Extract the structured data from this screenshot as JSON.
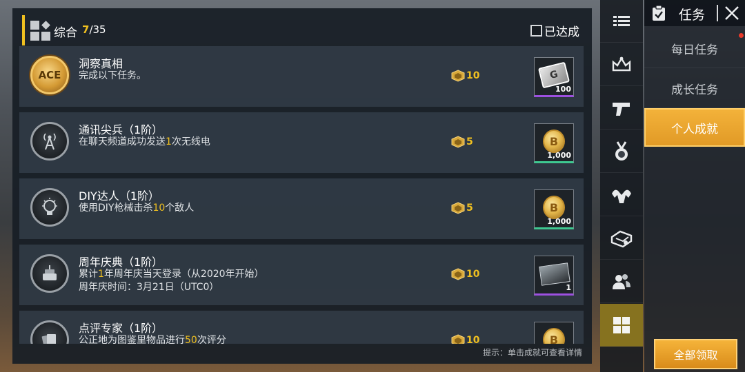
{
  "header": {
    "category": "综合",
    "progress_done": "7",
    "progress_total": "/35",
    "achieved_filter_label": "已达成"
  },
  "achievements": [
    {
      "title": "洞察真相",
      "desc_parts": [
        {
          "t": "完成以下任务。",
          "hl": false
        }
      ],
      "points": "10",
      "badge": "gold-ace-badge-icon",
      "reward_icon": "g-ticket-icon",
      "reward_count": "100",
      "reward_rarity": "purple"
    },
    {
      "title": "通讯尖兵（1阶）",
      "desc_parts": [
        {
          "t": "在聊天频道成功发送",
          "hl": false
        },
        {
          "t": "1",
          "hl": true
        },
        {
          "t": "次无线电",
          "hl": false
        }
      ],
      "points": "5",
      "badge": "radio-tower-badge-icon",
      "reward_icon": "bp-coin-icon",
      "reward_count": "1,000",
      "reward_rarity": "green"
    },
    {
      "title": "DIY达人（1阶）",
      "desc_parts": [
        {
          "t": "使用DIY枪械击杀",
          "hl": false
        },
        {
          "t": "10",
          "hl": true
        },
        {
          "t": "个敌人",
          "hl": false
        }
      ],
      "points": "5",
      "badge": "diy-bulb-badge-icon",
      "reward_icon": "bp-coin-icon",
      "reward_count": "1,000",
      "reward_rarity": "green"
    },
    {
      "title": "周年庆典（1阶）",
      "desc_parts": [
        {
          "t": "累计",
          "hl": false
        },
        {
          "t": "1",
          "hl": true
        },
        {
          "t": "年周年庆当天登录（从2020年开始）",
          "hl": false
        }
      ],
      "desc2": "周年庆时间：3月21日（UTC0）",
      "points": "10",
      "badge": "anniversary-cake-badge-icon",
      "reward_icon": "supply-crate-icon",
      "reward_count": "1",
      "reward_rarity": "purple"
    },
    {
      "title": "点评专家（1阶）",
      "desc_parts": [
        {
          "t": "公正地为图鉴里物品进行",
          "hl": false
        },
        {
          "t": "50",
          "hl": true
        },
        {
          "t": "次评分",
          "hl": false
        }
      ],
      "points": "10",
      "badge": "review-cards-badge-icon",
      "reward_icon": "bp-coin-icon",
      "reward_count": "",
      "reward_rarity": "green"
    }
  ],
  "footer_hint": "提示：单击成就可查看详情",
  "side_icons": [
    {
      "name": "menu-list-icon",
      "active": false
    },
    {
      "name": "crown-icon",
      "active": false
    },
    {
      "name": "pistol-icon",
      "active": false
    },
    {
      "name": "medal-icon",
      "active": false
    },
    {
      "name": "muscle-icon",
      "active": false
    },
    {
      "name": "vehicle-icon",
      "active": false
    },
    {
      "name": "friends-icon",
      "active": false
    },
    {
      "name": "grid-icon",
      "active": true
    }
  ],
  "panel": {
    "title": "任务",
    "tabs": [
      {
        "label": "每日任务",
        "active": false,
        "dot": true
      },
      {
        "label": "成长任务",
        "active": false,
        "dot": false
      },
      {
        "label": "个人成就",
        "active": true,
        "dot": false
      }
    ],
    "claim_all_label": "全部领取"
  },
  "colors": {
    "accent_yellow": "#f0c020",
    "tab_active_orange": "#e9a32e",
    "active_icon_olive": "#86721f",
    "rarity_purple": "#9d50e0",
    "rarity_green": "#3ec890",
    "notification_red": "#e83a2a"
  }
}
